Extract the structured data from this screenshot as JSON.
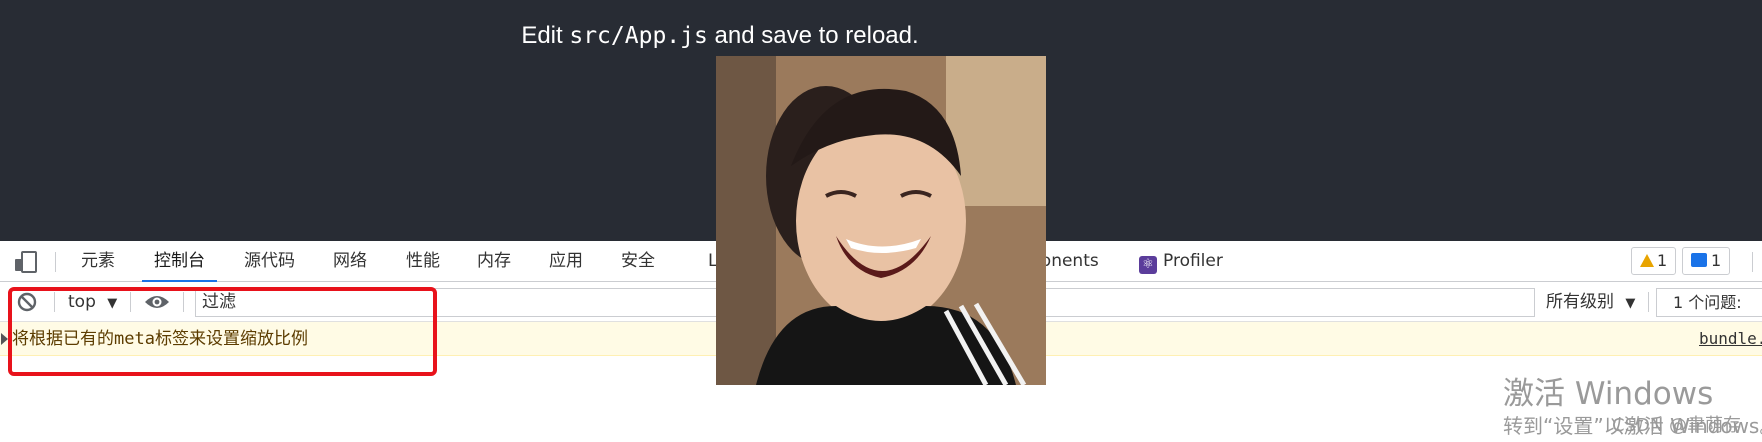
{
  "app": {
    "line_prefix": "Edit ",
    "line_code": "src/App.js",
    "line_suffix": " and save to reload."
  },
  "devtools": {
    "tabs": [
      {
        "label": "元素"
      },
      {
        "label": "控制台",
        "active": true
      },
      {
        "label": "源代码"
      },
      {
        "label": "网络"
      },
      {
        "label": "性能"
      },
      {
        "label": "内存"
      },
      {
        "label": "应用"
      },
      {
        "label": "安全"
      },
      {
        "label": "L"
      },
      {
        "label": "ponents"
      },
      {
        "label": "Profiler"
      }
    ],
    "warnings_count": "1",
    "messages_count": "1",
    "toolbar": {
      "context": "top",
      "filter_placeholder": "过滤",
      "levels": "所有级别",
      "issues": "1 个问题:"
    },
    "console_row": {
      "text": "将根据已有的meta标签来设置缩放比例",
      "source": "bundle."
    }
  },
  "overlay": {
    "watermark_title": "激活 Windows",
    "watermark_sub": "转到“设置”以激活 Windows。",
    "csdn": "CSDN @聿荫存"
  },
  "colors": {
    "app_bg": "#282c34",
    "active_tab_underline": "#1a73e8",
    "highlight": "#e8121b",
    "warning_row_bg": "#fffbe5"
  },
  "icons": [
    "device-toolbar-icon",
    "clear-console-icon",
    "eye-icon",
    "warning-icon",
    "message-icon",
    "react-profiler-icon",
    "dropdown-arrow-icon"
  ]
}
